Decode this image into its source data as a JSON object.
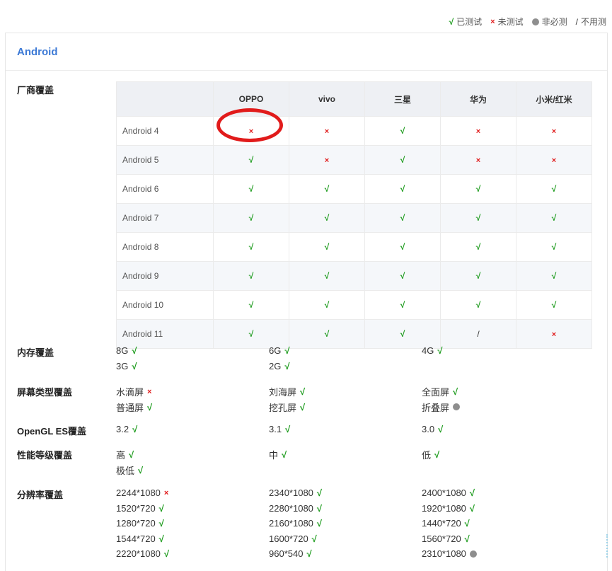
{
  "legend": {
    "items": [
      {
        "symbol": "√",
        "label": "已测试",
        "kind": "ok"
      },
      {
        "symbol": "×",
        "label": "未测试",
        "kind": "no"
      },
      {
        "symbol": "",
        "label": "非必测",
        "kind": "dot"
      },
      {
        "symbol": "/",
        "label": "不用测",
        "kind": "na"
      }
    ]
  },
  "panel": {
    "title": "Android"
  },
  "vendor": {
    "label": "厂商覆盖",
    "columns": [
      "OPPO",
      "vivo",
      "三星",
      "华为",
      "小米/红米"
    ],
    "rows": [
      {
        "name": "Android 4",
        "values": [
          "×",
          "×",
          "√",
          "×",
          "×"
        ]
      },
      {
        "name": "Android 5",
        "values": [
          "√",
          "×",
          "√",
          "×",
          "×"
        ]
      },
      {
        "name": "Android 6",
        "values": [
          "√",
          "√",
          "√",
          "√",
          "√"
        ]
      },
      {
        "name": "Android 7",
        "values": [
          "√",
          "√",
          "√",
          "√",
          "√"
        ]
      },
      {
        "name": "Android 8",
        "values": [
          "√",
          "√",
          "√",
          "√",
          "√"
        ]
      },
      {
        "name": "Android 9",
        "values": [
          "√",
          "√",
          "√",
          "√",
          "√"
        ]
      },
      {
        "name": "Android 10",
        "values": [
          "√",
          "√",
          "√",
          "√",
          "√"
        ]
      },
      {
        "name": "Android 11",
        "values": [
          "√",
          "√",
          "√",
          "/",
          "×"
        ]
      }
    ]
  },
  "memory": {
    "label": "内存覆盖",
    "items": [
      {
        "text": "8G",
        "status": "√"
      },
      {
        "text": "6G",
        "status": "√"
      },
      {
        "text": "4G",
        "status": "√"
      },
      {
        "text": "3G",
        "status": "√"
      },
      {
        "text": "2G",
        "status": "√"
      }
    ]
  },
  "screen": {
    "label": "屏幕类型覆盖",
    "items": [
      {
        "text": "水滴屏",
        "status": "×"
      },
      {
        "text": "刘海屏",
        "status": "√"
      },
      {
        "text": "全面屏",
        "status": "√"
      },
      {
        "text": "普通屏",
        "status": "√"
      },
      {
        "text": "挖孔屏",
        "status": "√"
      },
      {
        "text": "折叠屏",
        "status": "dot"
      }
    ]
  },
  "opengl": {
    "label": "OpenGL ES覆盖",
    "items": [
      {
        "text": "3.2",
        "status": "√"
      },
      {
        "text": "3.1",
        "status": "√"
      },
      {
        "text": "3.0",
        "status": "√"
      }
    ]
  },
  "performance": {
    "label": "性能等级覆盖",
    "items": [
      {
        "text": "高",
        "status": "√"
      },
      {
        "text": "中",
        "status": "√"
      },
      {
        "text": "低",
        "status": "√"
      },
      {
        "text": "极低",
        "status": "√"
      }
    ]
  },
  "resolution": {
    "label": "分辨率覆盖",
    "items": [
      {
        "text": "2244*1080",
        "status": "×"
      },
      {
        "text": "2340*1080",
        "status": "√"
      },
      {
        "text": "2400*1080",
        "status": "√"
      },
      {
        "text": "1520*720",
        "status": "√"
      },
      {
        "text": "2280*1080",
        "status": "√"
      },
      {
        "text": "1920*1080",
        "status": "√"
      },
      {
        "text": "1280*720",
        "status": "√"
      },
      {
        "text": "2160*1080",
        "status": "√"
      },
      {
        "text": "1440*720",
        "status": "√"
      },
      {
        "text": "1544*720",
        "status": "√"
      },
      {
        "text": "1600*720",
        "status": "√"
      },
      {
        "text": "1560*720",
        "status": "√"
      },
      {
        "text": "2220*1080",
        "status": "√"
      },
      {
        "text": "960*540",
        "status": "√"
      },
      {
        "text": "2310*1080",
        "status": "dot"
      }
    ]
  }
}
